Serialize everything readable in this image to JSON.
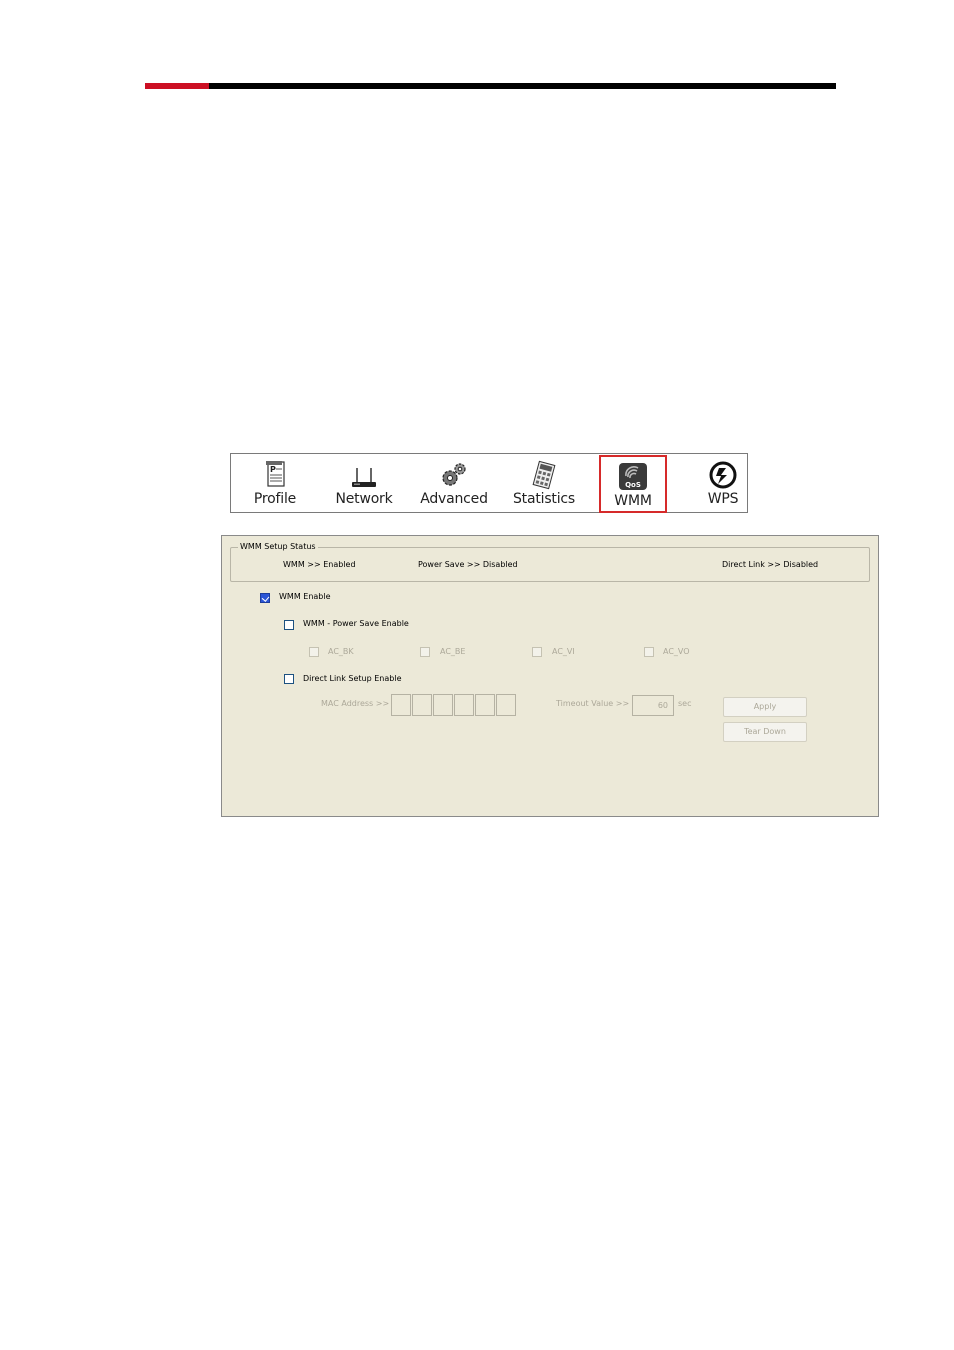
{
  "toolbar": {
    "items": [
      {
        "label": "Profile",
        "icon": "profile-icon"
      },
      {
        "label": "Network",
        "icon": "network-icon"
      },
      {
        "label": "Advanced",
        "icon": "advanced-icon"
      },
      {
        "label": "Statistics",
        "icon": "statistics-icon"
      },
      {
        "label": "WMM",
        "icon": "wmm-qos-icon",
        "selected": true,
        "icon_text": "QoS"
      },
      {
        "label": "WPS",
        "icon": "wps-icon"
      }
    ],
    "selected_color": "#d62a2a"
  },
  "wmm_panel": {
    "group_title": "WMM Setup Status",
    "status": {
      "wmm": "WMM >> Enabled",
      "power_save": "Power Save >> Disabled",
      "direct_link": "Direct Link >> Disabled"
    },
    "wmm_enable": {
      "label": "WMM Enable",
      "checked": true
    },
    "power_save_enable": {
      "label": "WMM - Power Save Enable",
      "checked": false
    },
    "access_categories": [
      {
        "label": "AC_BK"
      },
      {
        "label": "AC_BE"
      },
      {
        "label": "AC_VI"
      },
      {
        "label": "AC_VO"
      }
    ],
    "direct_link_enable": {
      "label": "Direct Link Setup Enable",
      "checked": false
    },
    "mac_address_label": "MAC Address >>",
    "timeout_label": "Timeout Value >>",
    "timeout_value": "60",
    "timeout_unit": "sec",
    "apply_label": "Apply",
    "tear_down_label": "Tear Down"
  },
  "colors": {
    "header_red": "#cc0f23",
    "header_black": "#000000",
    "panel_bg": "#ece9d8"
  }
}
